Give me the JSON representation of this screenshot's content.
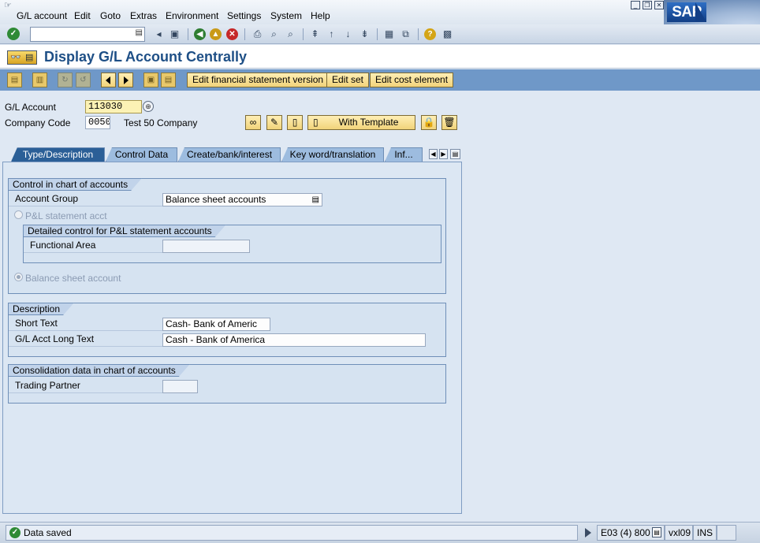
{
  "menu": {
    "items": [
      "G/L account",
      "Edit",
      "Goto",
      "Extras",
      "Environment",
      "Settings",
      "System",
      "Help"
    ],
    "underline": [
      "G",
      "E",
      "G",
      "x",
      "n",
      "S",
      "y",
      "H"
    ]
  },
  "logo": {
    "text": "SAP"
  },
  "toolbar": {
    "command_value": ""
  },
  "title": {
    "text": "Display G/L Account Centrally"
  },
  "app_toolbar": {
    "edit_fs_version": "Edit financial statement version",
    "edit_set": "Edit set",
    "edit_cost_element": "Edit cost element"
  },
  "header": {
    "gl_account_label": "G/L Account",
    "gl_account_value": "113030",
    "company_code_label": "Company Code",
    "company_code_value": "0050",
    "company_name": "Test 50 Company",
    "with_template": "With Template"
  },
  "tabs": [
    {
      "label": "Type/Description",
      "active": true
    },
    {
      "label": "Control Data",
      "active": false
    },
    {
      "label": "Create/bank/interest",
      "active": false
    },
    {
      "label": "Key word/translation",
      "active": false
    },
    {
      "label": "Inf...",
      "active": false
    }
  ],
  "control_group": {
    "title": "Control in chart of accounts",
    "account_group_label": "Account Group",
    "account_group_value": "Balance sheet accounts",
    "pl_radio_label": "P&L statement acct",
    "detailed_title": "Detailed control for P&L statement accounts",
    "functional_area_label": "Functional Area",
    "functional_area_value": "",
    "bs_radio_label": "Balance sheet account"
  },
  "description_group": {
    "title": "Description",
    "short_text_label": "Short Text",
    "short_text_value": "Cash- Bank of Americ",
    "long_text_label": "G/L Acct Long Text",
    "long_text_value": "Cash - Bank of America"
  },
  "consolidation_group": {
    "title": "Consolidation data in chart of accounts",
    "trading_partner_label": "Trading Partner",
    "trading_partner_value": ""
  },
  "status": {
    "message": "Data saved",
    "system": "E03 (4) 800",
    "server": "vxl09",
    "mode": "INS"
  },
  "colors": {
    "title": "#1e4f86",
    "app_toolbar": "#6f98c8",
    "active_tab": "#2b5f97",
    "button_yellow": "#f1d37a"
  }
}
